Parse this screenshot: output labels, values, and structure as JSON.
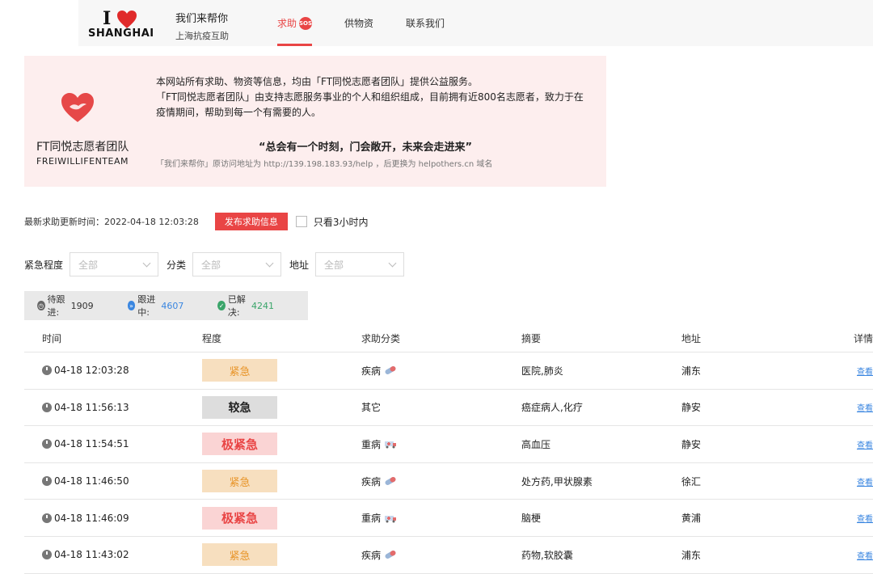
{
  "header": {
    "logo_i": "I",
    "logo_city": "SHANGHAI",
    "site_title": "我们来帮你",
    "site_subtitle": "上海抗疫互助",
    "nav": [
      {
        "label": "求助",
        "badge": "SOS"
      },
      {
        "label": "供物资"
      },
      {
        "label": "联系我们"
      }
    ]
  },
  "banner": {
    "team_name": "FT同悦志愿者团队",
    "team_en": "FREIWILLIFENTEAM",
    "intro_1": "本网站所有求助、物资等信息，均由「FT同悦志愿者团队」提供公益服务。",
    "intro_2": "「FT同悦志愿者团队」由支持志愿服务事业的个人和组织组成，目前拥有近800名志愿者，致力于在疫情期间，帮助到每一个有需要的人。",
    "quote": "“总会有一个时刻，门会敞开，未来会走进来”",
    "note": "「我们来帮你」原访问地址为 http://139.198.183.93/help ，后更换为 helpothers.cn 域名"
  },
  "toolbar": {
    "update_time": "最新求助更新时间：2022-04-18 12:03:28",
    "publish_label": "发布求助信息",
    "recent_only_label": "只看3小时内"
  },
  "filters": {
    "urgency_label": "紧急程度",
    "urgency_value": "全部",
    "category_label": "分类",
    "category_value": "全部",
    "address_label": "地址",
    "address_value": "全部"
  },
  "stats": {
    "pending_label": "待跟进:",
    "pending_value": "1909",
    "inprogress_label": "跟进中:",
    "inprogress_value": "4607",
    "resolved_label": "已解决:",
    "resolved_value": "4241"
  },
  "table": {
    "headers": [
      "时间",
      "程度",
      "求助分类",
      "摘要",
      "地址",
      "详情"
    ],
    "rows": [
      {
        "time": "04-18 12:03:28",
        "level": "紧急",
        "level_type": "urgent",
        "category": "疾病",
        "cat_icon": "pill-icon",
        "summary": "医院,肺炎",
        "address": "浦东",
        "detail": "查看"
      },
      {
        "time": "04-18 11:56:13",
        "level": "较急",
        "level_type": "fairly",
        "category": "其它",
        "cat_icon": "",
        "summary": "癌症病人,化疗",
        "address": "静安",
        "detail": "查看"
      },
      {
        "time": "04-18 11:54:51",
        "level": "极紧急",
        "level_type": "extreme",
        "category": "重病",
        "cat_icon": "ambulance-icon",
        "summary": "高血压",
        "address": "静安",
        "detail": "查看"
      },
      {
        "time": "04-18 11:46:50",
        "level": "紧急",
        "level_type": "urgent",
        "category": "疾病",
        "cat_icon": "pill-icon",
        "summary": "处方药,甲状腺素",
        "address": "徐汇",
        "detail": "查看"
      },
      {
        "time": "04-18 11:46:09",
        "level": "极紧急",
        "level_type": "extreme",
        "category": "重病",
        "cat_icon": "ambulance-icon",
        "summary": "脑梗",
        "address": "黄浦",
        "detail": "查看"
      },
      {
        "time": "04-18 11:43:02",
        "level": "紧急",
        "level_type": "urgent",
        "category": "疾病",
        "cat_icon": "pill-icon",
        "summary": "药物,软胶囊",
        "address": "浦东",
        "detail": "查看"
      }
    ]
  },
  "colors": {
    "accent": "#e94545",
    "banner_bg": "#fdeeee",
    "link": "#3a86e0",
    "resolved": "#3aa56a"
  }
}
